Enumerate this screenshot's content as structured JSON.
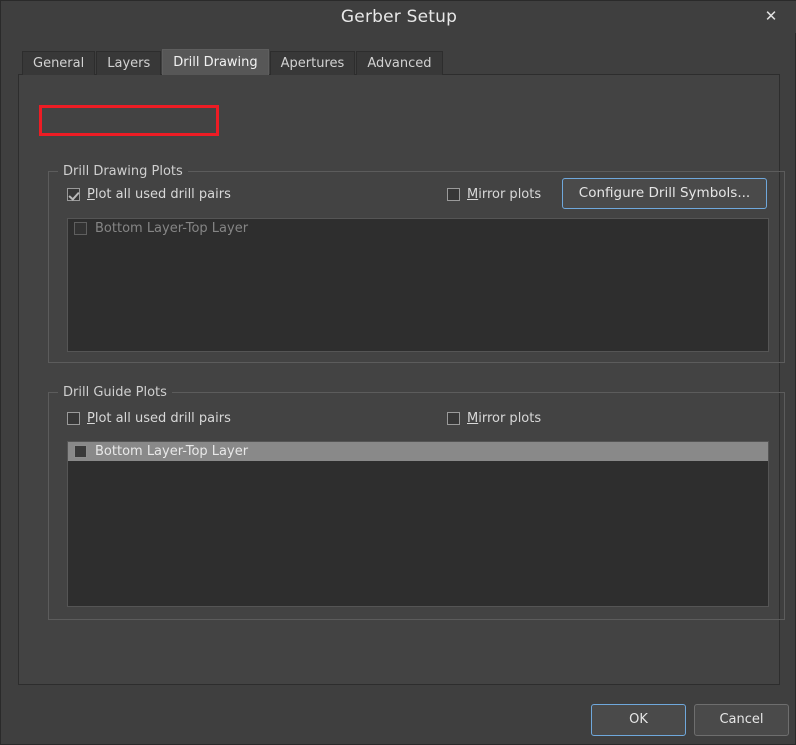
{
  "window": {
    "title": "Gerber Setup",
    "close_icon": "close-icon",
    "close_glyph": "✕"
  },
  "tabs": [
    {
      "label": "General",
      "active": false
    },
    {
      "label": "Layers",
      "active": false
    },
    {
      "label": "Drill Drawing",
      "active": true
    },
    {
      "label": "Apertures",
      "active": false
    },
    {
      "label": "Advanced",
      "active": false
    }
  ],
  "drill_drawing_plots": {
    "group_title": "Drill Drawing Plots",
    "plot_all": {
      "mnemonic": "P",
      "label_rest": "lot all used drill pairs",
      "checked": true,
      "highlighted": true
    },
    "mirror": {
      "mnemonic": "M",
      "label_rest": "irror plots",
      "checked": false
    },
    "configure_button": "Configure Drill Symbols...",
    "list_items": [
      {
        "label": "Bottom Layer-Top Layer",
        "checked": false,
        "selected": false,
        "disabled": true
      }
    ]
  },
  "drill_guide_plots": {
    "group_title": "Drill Guide Plots",
    "plot_all": {
      "mnemonic": "P",
      "label_rest": "lot all used drill pairs",
      "checked": false
    },
    "mirror": {
      "mnemonic": "M",
      "label_rest": "irror plots",
      "checked": false
    },
    "list_items": [
      {
        "label": "Bottom Layer-Top Layer",
        "checked": false,
        "selected": true,
        "disabled": false
      }
    ]
  },
  "footer": {
    "ok_label": "OK",
    "cancel_label": "Cancel"
  },
  "colors": {
    "dialog_bg": "#3f3f3f",
    "panel_bg": "#434343",
    "listbox_bg": "#2e2e2e",
    "selection": "#898989",
    "focus_border": "#6fa8dc",
    "highlight_red": "#ed1c24",
    "text": "#d8d8d8",
    "text_disabled": "#858585"
  }
}
